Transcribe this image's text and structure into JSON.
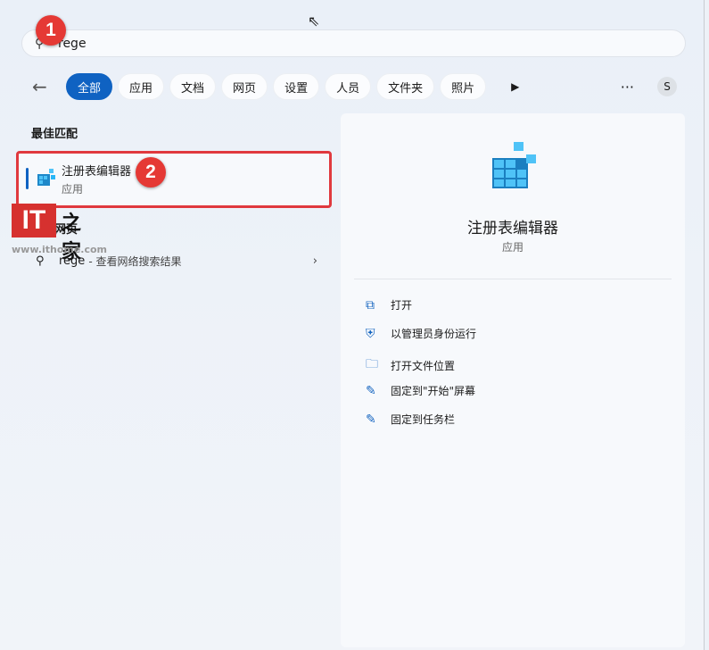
{
  "search": {
    "value": "rege",
    "icon": "search-icon"
  },
  "badges": [
    "1",
    "2"
  ],
  "filters": {
    "items": [
      "全部",
      "应用",
      "文档",
      "网页",
      "设置",
      "人员",
      "文件夹",
      "照片"
    ],
    "more_label": "···",
    "avatar": "S"
  },
  "best_match": {
    "heading": "最佳匹配",
    "title": "注册表编辑器",
    "subtitle": "应用"
  },
  "web_search": {
    "heading": "搜索网页",
    "query": "rege",
    "suffix": "- 查看网络搜索结果"
  },
  "watermark": {
    "logo": "IT之家",
    "url": "www.ithome.com"
  },
  "detail": {
    "title": "注册表编辑器",
    "subtitle": "应用",
    "actions": [
      {
        "label": "打开",
        "icon": "open-external-icon"
      },
      {
        "label": "以管理员身份运行",
        "icon": "admin-shield-icon"
      },
      {
        "label": "打开文件位置",
        "icon": "folder-icon"
      },
      {
        "label": "固定到\"开始\"屏幕",
        "icon": "pin-icon"
      },
      {
        "label": "固定到任务栏",
        "icon": "pin-icon"
      }
    ]
  },
  "colors": {
    "accent": "#0f62c2",
    "highlight": "#e0393e"
  }
}
